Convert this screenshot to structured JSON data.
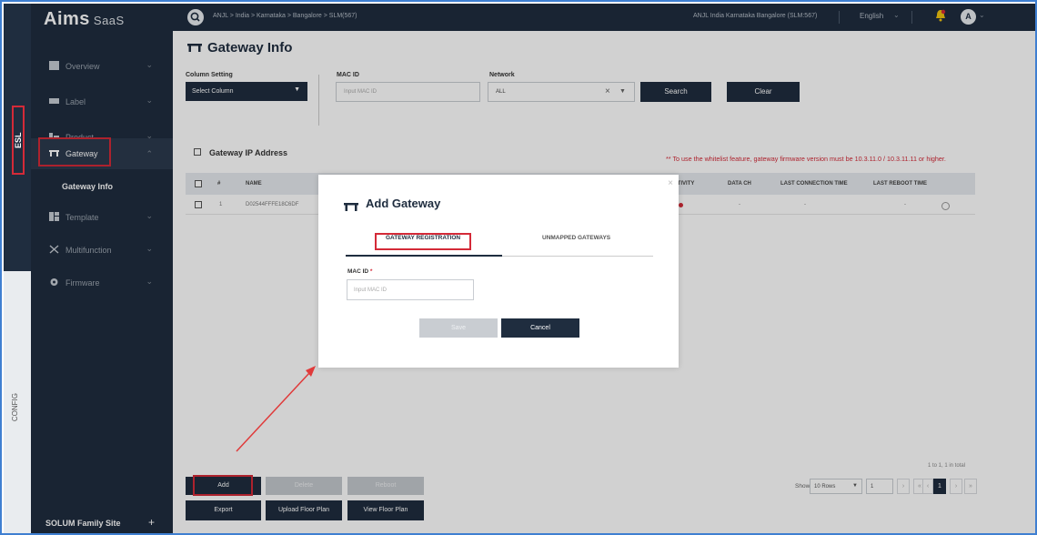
{
  "rail": {
    "esl_label": "ESL",
    "config_label": "CONFIG"
  },
  "sidebar": {
    "logo": "Aims",
    "logo_suffix": "SaaS",
    "items": [
      {
        "label": "Overview",
        "icon": "monitor-icon"
      },
      {
        "label": "Label",
        "icon": "label-icon"
      },
      {
        "label": "Product",
        "icon": "product-icon"
      },
      {
        "label": "Gateway",
        "icon": "gateway-icon"
      },
      {
        "label": "Template",
        "icon": "template-icon"
      },
      {
        "label": "Multifunction",
        "icon": "multifunction-icon"
      },
      {
        "label": "Firmware",
        "icon": "gear-icon"
      }
    ],
    "sub_item": "Gateway Info",
    "family_site": "SOLUM Family Site",
    "family_plus": "+"
  },
  "header": {
    "breadcrumb": "ANJL > India > Karnataka > Bangalore > SLM(567)",
    "store": "ANJL India Karnataka Bangalore (SLM:567)",
    "language": "English",
    "avatar_letter": "A"
  },
  "main": {
    "title": "Gateway Info",
    "column_setting_label": "Column Setting",
    "column_setting_value": "Select Column",
    "mac_id_label": "MAC ID",
    "mac_id_placeholder": "Input MAC ID",
    "network_label": "Network",
    "network_value": "ALL",
    "search_label": "Search",
    "clear_label": "Clear",
    "gateway_ip_label": "Gateway IP Address",
    "warning": "** To use the whitelist feature, gateway firmware version must be 10.3.11.0 / 10.3.11.11 or higher.",
    "table": {
      "headers": [
        "#",
        "NAME",
        "ACTIVITY",
        "DATA CH",
        "LAST CONNECTION TIME",
        "LAST REBOOT TIME"
      ],
      "rows": [
        {
          "num": "1",
          "name": "D02544FFFE18C6DF",
          "data_ch": "-",
          "last_conn": "-",
          "last_reboot": "-"
        }
      ]
    },
    "pagination": {
      "info": "1 to 1, 1 in total",
      "show_label": "Show",
      "rows_value": "10 Rows",
      "page_input": "1",
      "current_page": "1"
    },
    "buttons": {
      "add": "Add",
      "delete": "Delete",
      "reboot": "Reboot",
      "export": "Export",
      "upload_floor_plan": "Upload Floor Plan",
      "view_floor_plan": "View Floor Plan"
    }
  },
  "modal": {
    "title": "Add Gateway",
    "tab_registration": "GATEWAY REGISTRATION",
    "tab_unmapped": "UNMAPPED GATEWAYS",
    "mac_id_label": "MAC ID",
    "required_mark": "*",
    "mac_id_placeholder": "Input MAC ID",
    "save": "Save",
    "cancel": "Cancel"
  },
  "colors": {
    "navy": "#1f2d3f",
    "highlight_red": "#d42a38",
    "frame_blue": "#3f7fd1"
  }
}
